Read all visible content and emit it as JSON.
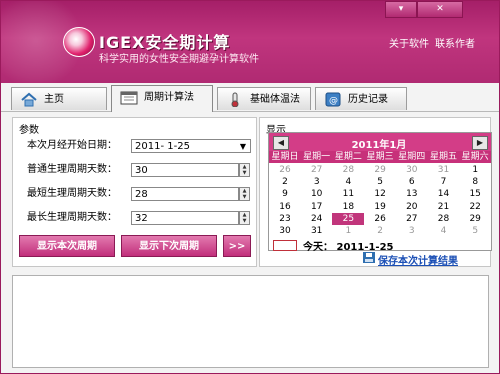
{
  "app": {
    "logo_text": "IGEX安全期计算",
    "subtitle": "科学实用的女性安全期避孕计算软件",
    "links": {
      "about": "关于软件",
      "contact": "联系作者"
    },
    "window_controls": {
      "minimize": "▾",
      "close": "✕"
    }
  },
  "tabs": [
    {
      "label": "主页",
      "icon": "home-icon"
    },
    {
      "label": "周期计算法",
      "icon": "calendar-icon"
    },
    {
      "label": "基础体温法",
      "icon": "thermometer-icon"
    },
    {
      "label": "历史记录",
      "icon": "history-icon"
    }
  ],
  "params": {
    "title": "参数",
    "fields": [
      {
        "label": "本次月经开始日期：",
        "value": "2011- 1-25"
      },
      {
        "label": "普通生理周期天数：",
        "value": "30"
      },
      {
        "label": "最短生理周期天数：",
        "value": "28"
      },
      {
        "label": "最长生理周期天数：",
        "value": "32"
      }
    ],
    "buttons": {
      "show_current": "显示本次周期",
      "show_next": "显示下次周期",
      "more": ">>"
    }
  },
  "display": {
    "title": "显示",
    "calendar": {
      "month_label": "2011年1月",
      "prev": "◀",
      "next": "▶",
      "weekdays": [
        "星期日",
        "星期一",
        "星期二",
        "星期三",
        "星期四",
        "星期五",
        "星期六"
      ],
      "weeks": [
        [
          "26",
          "27",
          "28",
          "29",
          "30",
          "31",
          "1"
        ],
        [
          "2",
          "3",
          "4",
          "5",
          "6",
          "7",
          "8"
        ],
        [
          "9",
          "10",
          "11",
          "12",
          "13",
          "14",
          "15"
        ],
        [
          "16",
          "17",
          "18",
          "19",
          "20",
          "21",
          "22"
        ],
        [
          "23",
          "24",
          "25",
          "26",
          "27",
          "28",
          "29"
        ],
        [
          "30",
          "31",
          "1",
          "2",
          "3",
          "4",
          "5"
        ]
      ],
      "selected": "25",
      "today_label": "今天：",
      "today_value": "2011-1-25"
    },
    "save_label": "保存本次计算结果"
  },
  "colors": {
    "brand": "#b02a72",
    "selected": "#c1357b",
    "link": "#1b4fb5"
  }
}
